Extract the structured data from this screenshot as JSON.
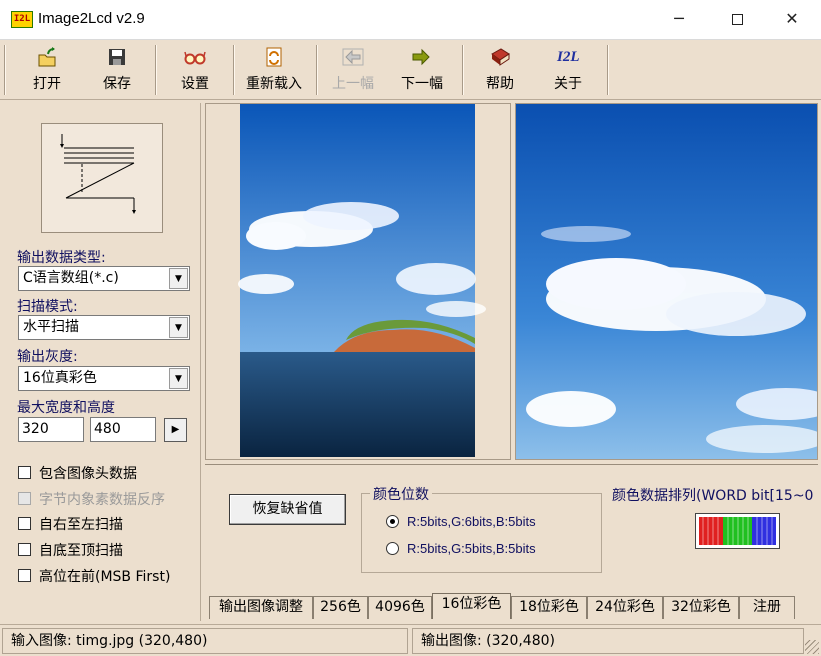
{
  "window": {
    "title": "Image2Lcd v2.9",
    "icon_text": "I2L"
  },
  "toolbar": [
    {
      "label": "打开",
      "icon": "open-icon",
      "enabled": true
    },
    {
      "label": "保存",
      "icon": "save-icon",
      "enabled": true
    },
    {
      "label": "设置",
      "icon": "settings-glasses-icon",
      "enabled": true
    },
    {
      "label": "重新载入",
      "icon": "reload-icon",
      "enabled": true
    },
    {
      "label": "上一幅",
      "icon": "prev-arrow-icon",
      "enabled": false
    },
    {
      "label": "下一幅",
      "icon": "next-arrow-icon",
      "enabled": true
    },
    {
      "label": "帮助",
      "icon": "help-book-icon",
      "enabled": true
    },
    {
      "label": "关于",
      "icon": "i2l-logo-icon",
      "enabled": true,
      "icon_text": "I2L"
    }
  ],
  "left": {
    "output_type_label": "输出数据类型:",
    "output_type_value": "C语言数组(*.c)",
    "scan_mode_label": "扫描模式:",
    "scan_mode_value": "水平扫描",
    "gray_label": "输出灰度:",
    "gray_value": "16位真彩色",
    "size_label": "最大宽度和高度",
    "width": "320",
    "height": "480",
    "checkboxes": [
      {
        "label": "包含图像头数据",
        "checked": false,
        "enabled": true
      },
      {
        "label": "字节内象素数据反序",
        "checked": false,
        "enabled": false
      },
      {
        "label": "自右至左扫描",
        "checked": false,
        "enabled": true
      },
      {
        "label": "自底至顶扫描",
        "checked": false,
        "enabled": true
      },
      {
        "label": "高位在前(MSB First)",
        "checked": false,
        "enabled": true
      }
    ]
  },
  "settings": {
    "restore_label": "恢复缺省值",
    "color_bits_title": "颜色位数",
    "radio_options": [
      {
        "label": "R:5bits,G:6bits,B:5bits",
        "selected": true
      },
      {
        "label": "R:5bits,G:5bits,B:5bits",
        "selected": false
      }
    ],
    "order_title": "颜色数据排列(WORD bit[15~0",
    "order_colors": [
      "#e02020",
      "#20c020",
      "#3030e0"
    ]
  },
  "tabs": [
    {
      "label": "输出图像调整",
      "active": false
    },
    {
      "label": "256色",
      "active": false
    },
    {
      "label": "4096色",
      "active": false
    },
    {
      "label": "16位彩色",
      "active": true
    },
    {
      "label": "18位彩色",
      "active": false
    },
    {
      "label": "24位彩色",
      "active": false
    },
    {
      "label": "32位彩色",
      "active": false
    },
    {
      "label": "注册",
      "active": false
    }
  ],
  "status": {
    "input": "输入图像: timg.jpg (320,480)",
    "output": "输出图像: (320,480)"
  }
}
